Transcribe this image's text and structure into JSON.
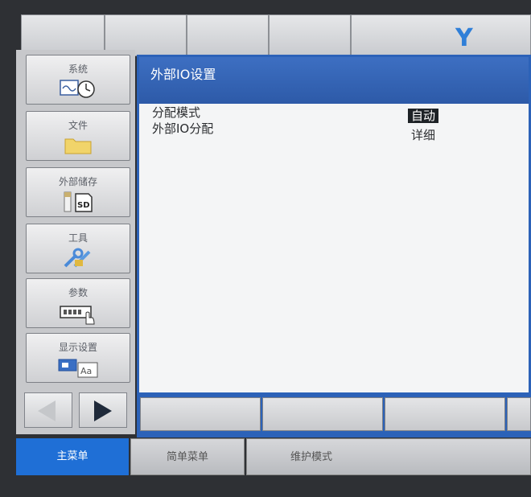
{
  "brand": {
    "logo_letter": "Y",
    "logo_color": "#2f7fd8"
  },
  "left_menu": [
    {
      "label": "系统",
      "icon": "system-clock-icon"
    },
    {
      "label": "文件",
      "icon": "folder-icon"
    },
    {
      "label": "外部储存",
      "icon": "sd-card-icon"
    },
    {
      "label": "工具",
      "icon": "tools-icon"
    },
    {
      "label": "参数",
      "icon": "parameters-hand-icon"
    },
    {
      "label": "显示设置",
      "icon": "display-settings-icon"
    }
  ],
  "main": {
    "title": "外部IO设置",
    "rows": [
      {
        "label": "分配模式",
        "value": "自动",
        "selected": true
      },
      {
        "label": "外部IO分配",
        "value": "详细",
        "selected": false
      }
    ]
  },
  "bottom_tabs": [
    {
      "label": "主菜单",
      "active": true
    },
    {
      "label": "简单菜单",
      "active": false
    },
    {
      "label": "维护模式",
      "active": false
    }
  ],
  "colors": {
    "accent": "#2c62b8",
    "active_tab": "#1f6fd6"
  }
}
